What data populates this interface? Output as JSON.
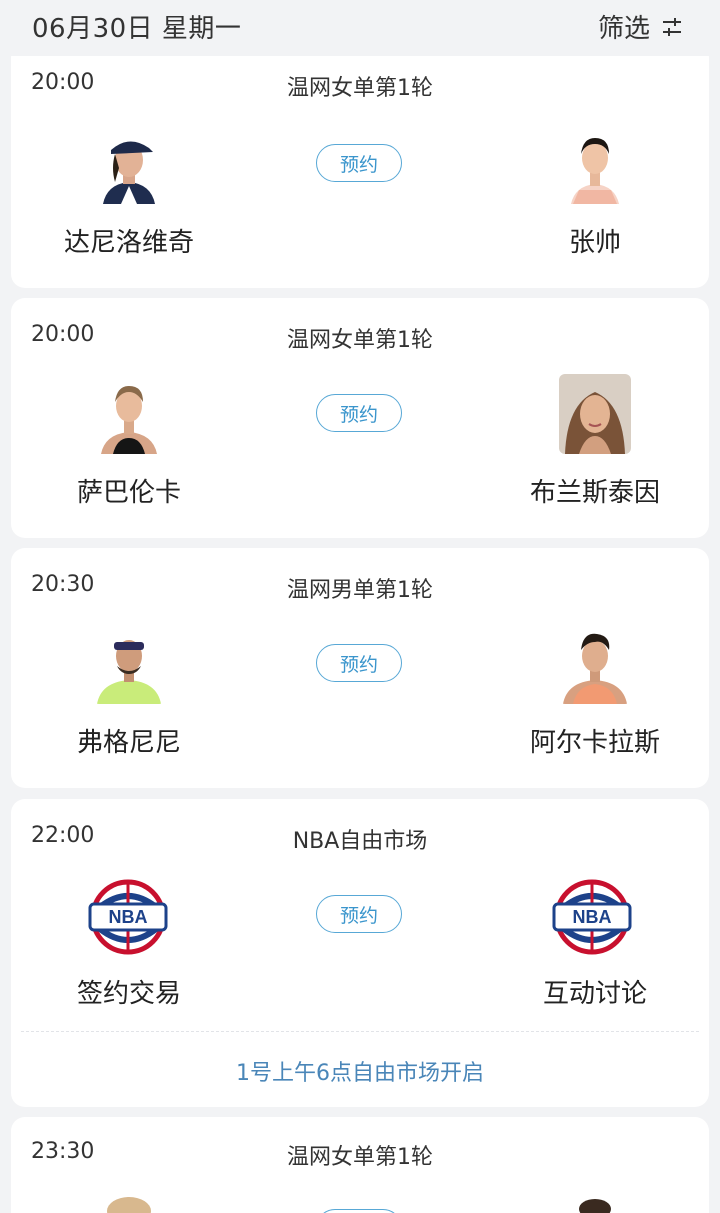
{
  "header": {
    "date_label": "06月30日 星期一",
    "filter_label": "筛选"
  },
  "reserve_label": "预约",
  "matches": [
    {
      "time": "20:00",
      "event": "温网女单第1轮",
      "left_name": "达尼洛维奇",
      "right_name": "张帅"
    },
    {
      "time": "20:00",
      "event": "温网女单第1轮",
      "left_name": "萨巴伦卡",
      "right_name": "布兰斯泰因"
    },
    {
      "time": "20:30",
      "event": "温网男单第1轮",
      "left_name": "弗格尼尼",
      "right_name": "阿尔卡拉斯"
    },
    {
      "time": "22:00",
      "event": "NBA自由市场",
      "left_name": "签约交易",
      "right_name": "互动讨论",
      "logo_text": "NBA",
      "note": "1号上午6点自由市场开启"
    },
    {
      "time": "23:30",
      "event": "温网女单第1轮"
    }
  ],
  "colors": {
    "background": "#f2f3f5",
    "card": "#ffffff",
    "accent_blue": "#3a95cc",
    "note_blue": "#4a86b8",
    "nba_blue": "#1d428a",
    "nba_red": "#c8102e"
  }
}
